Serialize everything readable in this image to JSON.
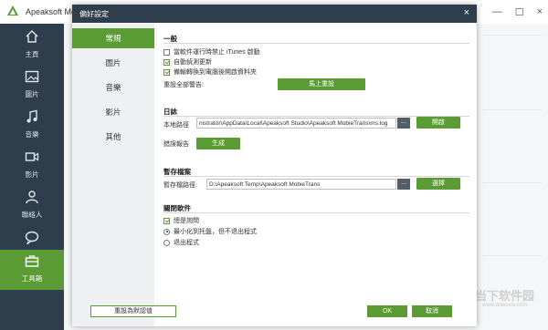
{
  "app": {
    "title": "Apeaksoft Mobie",
    "controls": [
      "—",
      "☐",
      "×"
    ],
    "nav": [
      {
        "label": "主頁",
        "icon": "home-icon"
      },
      {
        "label": "圖片",
        "icon": "picture-icon"
      },
      {
        "label": "音樂",
        "icon": "music-icon"
      },
      {
        "label": "影片",
        "icon": "video-icon"
      },
      {
        "label": "聯絡人",
        "icon": "contacts-icon"
      },
      {
        "label": "訊息",
        "icon": "message-icon"
      },
      {
        "label": "工具箱",
        "icon": "toolbox-icon"
      }
    ],
    "active_nav": "工具箱"
  },
  "dialog": {
    "title": "偏好設定",
    "close": "×",
    "tabs": [
      "常規",
      "圖片",
      "音樂",
      "影片",
      "其他"
    ],
    "active_tab": "常規",
    "general": {
      "title": "一般",
      "options": [
        {
          "label": "當軟件運行時禁止 iTunes 啟動",
          "checked": false
        },
        {
          "label": "自動偵測更新",
          "checked": true
        },
        {
          "label": "備輸轉換到電腦後開啟資料夾",
          "checked": true
        }
      ],
      "reset_prompts_label": "重設全部警告:",
      "reset_now_button": "馬上重設"
    },
    "log": {
      "title": "日誌",
      "local_path_label": "本地路徑",
      "local_path_value": "nistrator\\AppData\\Local\\Apeaksoft Studio\\Apeaksoft MobieTrans\\ms.log",
      "browse_button": "...",
      "open_button": "開啟",
      "error_report_label": "錯誤報告",
      "generate_button": "生成"
    },
    "temp": {
      "title": "暫存檔案",
      "folder_label": "暫存檔路徑:",
      "folder_value": "D:\\Apeaksoft Temp\\Apeaksoft MobieTrans",
      "browse_button": "...",
      "select_button": "選擇"
    },
    "close_software": {
      "title": "關閉軟件",
      "remind_label": "總是詢問",
      "remind_checked": true,
      "options": [
        {
          "label": "最小化到托盤，但不退出程式",
          "checked": true
        },
        {
          "label": "退出程式",
          "checked": false
        }
      ]
    },
    "footer": {
      "reset_default": "重設為默認值",
      "ok": "OK",
      "cancel": "取消"
    }
  },
  "watermark": {
    "text": "当下软件园",
    "url": "www.downxia.com"
  },
  "colors": {
    "accent": "#5b9b33",
    "sidebar": "#2f3e4c",
    "dialog_side": "#eef0f2"
  }
}
